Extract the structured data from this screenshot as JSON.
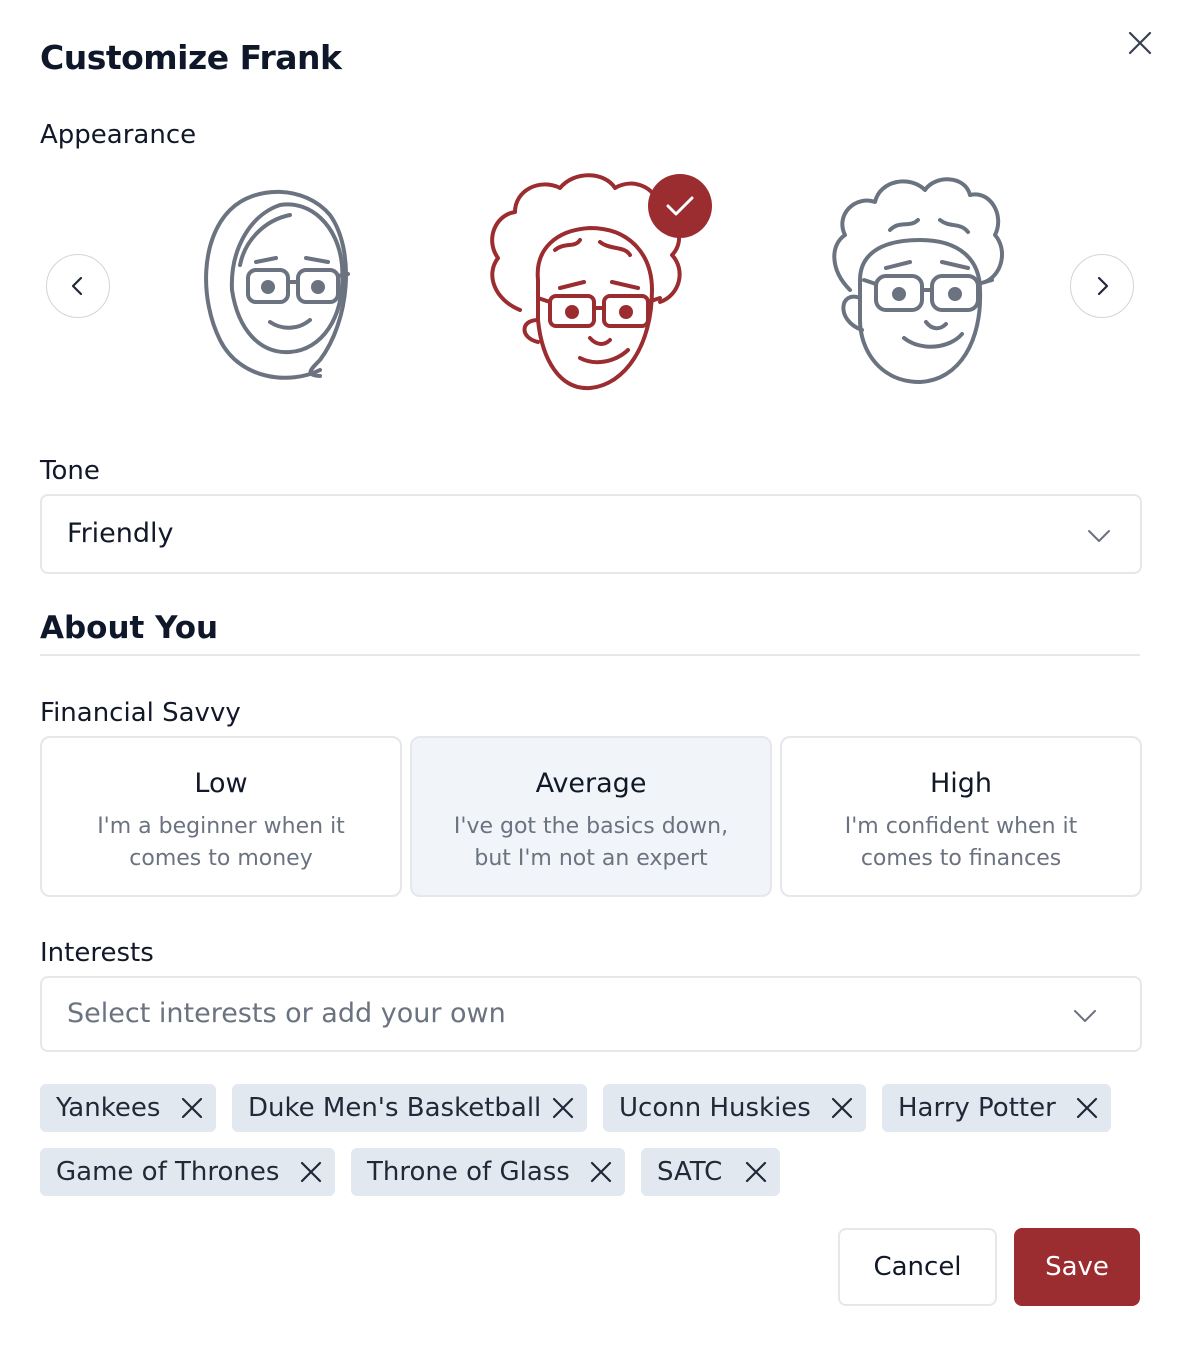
{
  "modal": {
    "title": "Customize Frank",
    "close_icon": "close-icon"
  },
  "appearance": {
    "label": "Appearance",
    "selected_index": 1,
    "selected_color": "#9b2d30",
    "avatars": [
      {
        "name": "avatar-hijab-glasses"
      },
      {
        "name": "avatar-curly-afro-glasses"
      },
      {
        "name": "avatar-curly-short-glasses"
      }
    ]
  },
  "tone": {
    "label": "Tone",
    "value": "Friendly"
  },
  "about": {
    "heading": "About You"
  },
  "savvy": {
    "label": "Financial Savvy",
    "selected": "Average",
    "options": [
      {
        "title": "Low",
        "desc": "I'm a beginner when it comes to money"
      },
      {
        "title": "Average",
        "desc": "I've got the basics down, but I'm not an expert"
      },
      {
        "title": "High",
        "desc": "I'm confident when it comes to finances"
      }
    ]
  },
  "interests": {
    "label": "Interests",
    "placeholder": "Select interests or add your own",
    "chips": [
      "Yankees",
      "Duke Men's Basketball",
      "Uconn Huskies",
      "Harry Potter",
      "Game of Thrones",
      "Throne of Glass",
      "SATC"
    ]
  },
  "actions": {
    "cancel": "Cancel",
    "save": "Save"
  }
}
